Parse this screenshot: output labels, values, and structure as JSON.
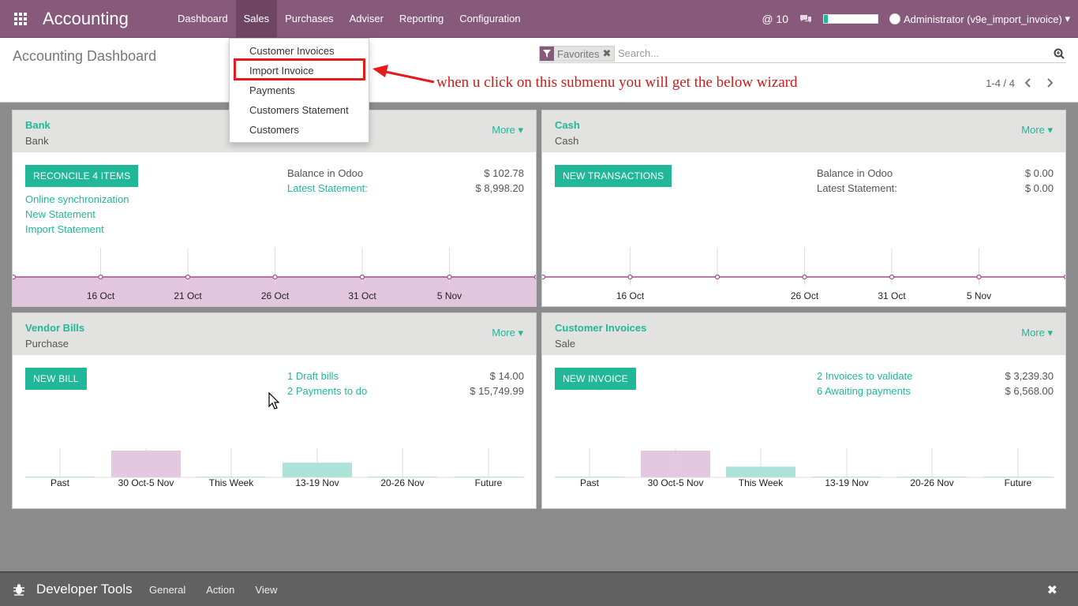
{
  "navbar": {
    "brand": "Accounting",
    "menu": [
      "Dashboard",
      "Sales",
      "Purchases",
      "Adviser",
      "Reporting",
      "Configuration"
    ],
    "active_menu": "Sales",
    "mentions": "@ 10",
    "user": "Administrator (v9e_import_invoice)",
    "progress": 0.07
  },
  "control_panel": {
    "title": "Accounting Dashboard",
    "facet_label": "Favorites",
    "search_placeholder": "Search...",
    "pager": "1-4 / 4"
  },
  "sales_menu": {
    "items": [
      "Customer Invoices",
      "Import Invoice",
      "Payments",
      "Customers Statement",
      "Customers"
    ],
    "highlighted": "Import Invoice"
  },
  "annotation": "when u click on this submenu you will get the below wizard",
  "cards": {
    "bank": {
      "title": "Bank",
      "subtitle": "Bank",
      "more": "More",
      "button": "RECONCILE 4 ITEMS",
      "links": [
        "Online synchronization",
        "New Statement",
        "Import Statement"
      ],
      "stats": [
        {
          "label": "Balance in Odoo",
          "value": "$ 102.78"
        },
        {
          "label": "Latest Statement:",
          "value": "$ 8,998.20"
        }
      ],
      "chart_data": {
        "type": "area",
        "x": [
          "",
          "16 Oct",
          "21 Oct",
          "26 Oct",
          "31 Oct",
          "5 Nov",
          ""
        ],
        "values": [
          0,
          0,
          0,
          0,
          0,
          0,
          0
        ],
        "fill": "#e2c6dd",
        "line": "#a34d91"
      }
    },
    "cash": {
      "title": "Cash",
      "subtitle": "Cash",
      "more": "More",
      "button": "NEW TRANSACTIONS",
      "stats": [
        {
          "label": "Balance in Odoo",
          "value": "$ 0.00"
        },
        {
          "label": "Latest Statement:",
          "value": "$ 0.00"
        }
      ],
      "chart_data": {
        "type": "line",
        "x": [
          "",
          "16 Oct",
          "",
          "26 Oct",
          "31 Oct",
          "5 Nov",
          ""
        ],
        "values": [
          0,
          0,
          0,
          0,
          0,
          0,
          0
        ],
        "line": "#a34d91"
      }
    },
    "vendor_bills": {
      "title": "Vendor Bills",
      "subtitle": "Purchase",
      "more": "More",
      "button": "NEW BILL",
      "stats": [
        {
          "label": "1 Draft bills",
          "value": "$ 14.00"
        },
        {
          "label": "2 Payments to do",
          "value": "$ 15,749.99"
        }
      ],
      "chart_data": {
        "type": "bar",
        "categories": [
          "Past",
          "30 Oct-5 Nov",
          "This Week",
          "13-19 Nov",
          "20-26 Nov",
          "Future"
        ],
        "values": [
          0,
          1.0,
          0,
          0.55,
          0,
          0
        ],
        "colors": [
          "#a8e0d6",
          "#e2c6dd",
          "#a8e0d6",
          "#a8e0d6",
          "#a8e0d6",
          "#a8e0d6"
        ]
      }
    },
    "customer_invoices": {
      "title": "Customer Invoices",
      "subtitle": "Sale",
      "more": "More",
      "button": "NEW INVOICE",
      "stats": [
        {
          "label": "2 Invoices to validate",
          "value": "$ 3,239.30"
        },
        {
          "label": "6 Awaiting payments",
          "value": "$ 6,568.00"
        }
      ],
      "chart_data": {
        "type": "bar",
        "categories": [
          "Past",
          "30 Oct-5 Nov",
          "This Week",
          "13-19 Nov",
          "20-26 Nov",
          "Future"
        ],
        "values": [
          0,
          1.0,
          0.4,
          0,
          0,
          0
        ],
        "colors": [
          "#a8e0d6",
          "#e2c6dd",
          "#a8e0d6",
          "#a8e0d6",
          "#a8e0d6",
          "#a8e0d6"
        ]
      }
    }
  },
  "devtools": {
    "title": "Developer Tools",
    "menu": [
      "General",
      "Action",
      "View"
    ]
  },
  "colors": {
    "brand": "#875a7b",
    "accent": "#21b799",
    "annotation": "#e21b1b"
  }
}
